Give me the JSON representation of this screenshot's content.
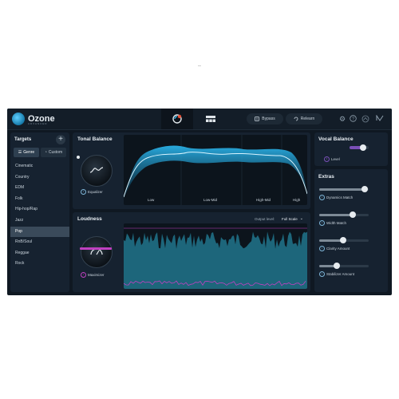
{
  "stray_mark": "..",
  "header": {
    "logo_text": "Ozone",
    "logo_sub": "ADVANCED",
    "bypass_label": "Bypass",
    "relearn_label": "Relearn"
  },
  "targets": {
    "title": "Targets",
    "genre_tab": "Genre",
    "custom_tab": "Custom",
    "genres": [
      {
        "label": "Cinematic"
      },
      {
        "label": "Country"
      },
      {
        "label": "EDM"
      },
      {
        "label": "Folk"
      },
      {
        "label": "Hip-hop/Rap"
      },
      {
        "label": "Jazz"
      },
      {
        "label": "Pop"
      },
      {
        "label": "RnB/Soul"
      },
      {
        "label": "Reggae"
      },
      {
        "label": "Rock"
      }
    ],
    "selected_genre": "Pop"
  },
  "tonal_balance": {
    "title": "Tonal Balance",
    "knob_label": "Equalizer",
    "bands": [
      "Low",
      "Low-Mid",
      "High-Mid",
      "High"
    ]
  },
  "loudness": {
    "title": "Loudness",
    "knob_label": "Maximizer",
    "output_level_label": "Output level:",
    "output_level_value": "Full Scale"
  },
  "vocal_balance": {
    "title": "Vocal Balance",
    "level_label": "Level",
    "level_value": 0.7
  },
  "extras": {
    "title": "Extras",
    "sliders": [
      {
        "label": "Dynamics Match",
        "value": 0.92
      },
      {
        "label": "Width Match",
        "value": 0.68
      },
      {
        "label": "Clarity Amount",
        "value": 0.48
      },
      {
        "label": "Stabilizer Amount",
        "value": 0.35
      }
    ]
  },
  "colors": {
    "accent": "#3ab8ea",
    "magenta": "#c040c0",
    "panel": "#162230",
    "background": "#0f1822"
  }
}
